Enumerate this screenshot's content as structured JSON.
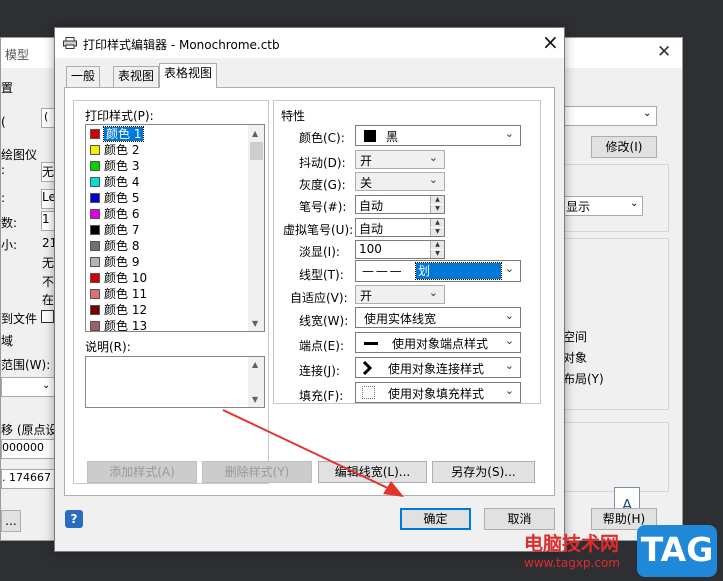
{
  "background_dialog": {
    "title": "模型",
    "labels": [
      "置",
      "绘图仪",
      "数:",
      "小:",
      "到文件",
      "域",
      "范围(W):",
      "移 (原点设"
    ],
    "fields": [
      "(",
      "无",
      "Le",
      "1",
      "21",
      "无",
      "不",
      "在",
      "000000",
      ". 174667"
    ],
    "right_buttons": {
      "modify": "修改(I)",
      "help": "帮助(H)"
    },
    "right_labels": [
      "显示",
      "空间",
      "对象",
      "布局(Y)"
    ],
    "file_icon_letter": "A",
    "dots_btn": "..."
  },
  "dialog": {
    "title": "打印样式编辑器 - Monochrome.ctb",
    "tabs": [
      {
        "label": "一般",
        "active": false
      },
      {
        "label": "表视图",
        "active": false
      },
      {
        "label": "表格视图",
        "active": true
      }
    ],
    "print_styles_label": "打印样式(P):",
    "styles": [
      {
        "name": "颜色 1",
        "color": "#d40000",
        "selected": true
      },
      {
        "name": "颜色 2",
        "color": "#f2f200"
      },
      {
        "name": "颜色 3",
        "color": "#00d400"
      },
      {
        "name": "颜色 4",
        "color": "#00dede"
      },
      {
        "name": "颜色 5",
        "color": "#0000d4"
      },
      {
        "name": "颜色 6",
        "color": "#e000e0"
      },
      {
        "name": "颜色 7",
        "color": "#000000"
      },
      {
        "name": "颜色 8",
        "color": "#707070"
      },
      {
        "name": "颜色 9",
        "color": "#b4b4b4"
      },
      {
        "name": "颜色 10",
        "color": "#d40000"
      },
      {
        "name": "颜色 11",
        "color": "#e07070"
      },
      {
        "name": "颜色 12",
        "color": "#7a0000"
      },
      {
        "name": "颜色 13",
        "color": "#a06060"
      }
    ],
    "description_label": "说明(R):",
    "properties": {
      "title": "特性",
      "color": {
        "label": "颜色(C):",
        "value": "黑",
        "swatch": "#000000"
      },
      "dither": {
        "label": "抖动(D):",
        "value": "开"
      },
      "grayscale": {
        "label": "灰度(G):",
        "value": "关"
      },
      "pen": {
        "label": "笔号(#):",
        "value": "自动"
      },
      "virtual_pen": {
        "label": "虚拟笔号(U):",
        "value": "自动"
      },
      "screening": {
        "label": "淡显(I):",
        "value": "100"
      },
      "linetype": {
        "label": "线型(T):",
        "value": "划",
        "pattern": "— — —"
      },
      "adaptive": {
        "label": "自适应(V):",
        "value": "开"
      },
      "lineweight": {
        "label": "线宽(W):",
        "value": "使用实体线宽"
      },
      "endstyle": {
        "label": "端点(E):",
        "value": "使用对象端点样式"
      },
      "joinstyle": {
        "label": "连接(J):",
        "value": "使用对象连接样式"
      },
      "fillstyle": {
        "label": "填充(F):",
        "value": "使用对象填充样式"
      }
    },
    "buttons": {
      "add_style": "添加样式(A)",
      "delete_style": "删除样式(Y)",
      "edit_lineweights": "编辑线宽(L)...",
      "save_as": "另存为(S)...",
      "ok": "确定",
      "cancel": "取消",
      "help_icon": "?"
    }
  },
  "watermark": {
    "text": "电脑技术网",
    "url": "www.tagxp.com",
    "tag": "TAG"
  },
  "colors": {
    "selection": "#0078d7",
    "annotation_arrow": "#e5322d",
    "watermark_red": "#e02c2c",
    "watermark_blue": "#1f88d9"
  }
}
